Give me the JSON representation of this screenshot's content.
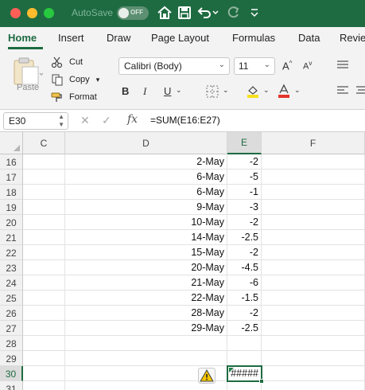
{
  "titlebar": {
    "autosave_label": "AutoSave",
    "autosave_state": "OFF"
  },
  "ribbon_tabs": [
    "Home",
    "Insert",
    "Draw",
    "Page Layout",
    "Formulas",
    "Data",
    "Revie"
  ],
  "ribbon": {
    "paste_label": "Paste",
    "cut_label": "Cut",
    "copy_label": "Copy",
    "format_label": "Format",
    "font_name": "Calibri (Body)",
    "font_size": "11",
    "grow_font": "A",
    "shrink_font": "A",
    "bold": "B",
    "italic": "I",
    "underline": "U"
  },
  "formula_bar": {
    "name_box": "E30",
    "fx_label": "fx",
    "formula": "=SUM(E16:E27)"
  },
  "columns": [
    "C",
    "D",
    "E",
    "F"
  ],
  "selected_column": "E",
  "rows": [
    {
      "row": "16",
      "d": "2-May",
      "e": "-2"
    },
    {
      "row": "17",
      "d": "6-May",
      "e": "-5"
    },
    {
      "row": "18",
      "d": "6-May",
      "e": "-1"
    },
    {
      "row": "19",
      "d": "9-May",
      "e": "-3"
    },
    {
      "row": "20",
      "d": "10-May",
      "e": "-2"
    },
    {
      "row": "21",
      "d": "14-May",
      "e": "-2.5"
    },
    {
      "row": "22",
      "d": "15-May",
      "e": "-2"
    },
    {
      "row": "23",
      "d": "20-May",
      "e": "-4.5"
    },
    {
      "row": "24",
      "d": "21-May",
      "e": "-6"
    },
    {
      "row": "25",
      "d": "22-May",
      "e": "-1.5"
    },
    {
      "row": "26",
      "d": "28-May",
      "e": "-2"
    },
    {
      "row": "27",
      "d": "29-May",
      "e": "-2.5"
    },
    {
      "row": "28",
      "d": "",
      "e": ""
    },
    {
      "row": "29",
      "d": "",
      "e": ""
    },
    {
      "row": "30",
      "d": "",
      "e": "#####"
    },
    {
      "row": "31",
      "d": "",
      "e": ""
    }
  ],
  "active_cell": {
    "row": "30",
    "value": "#####"
  },
  "colors": {
    "excel_green": "#1e6b41",
    "error_indicator": "#1e7f46",
    "warning_yellow": "#f5c400"
  }
}
